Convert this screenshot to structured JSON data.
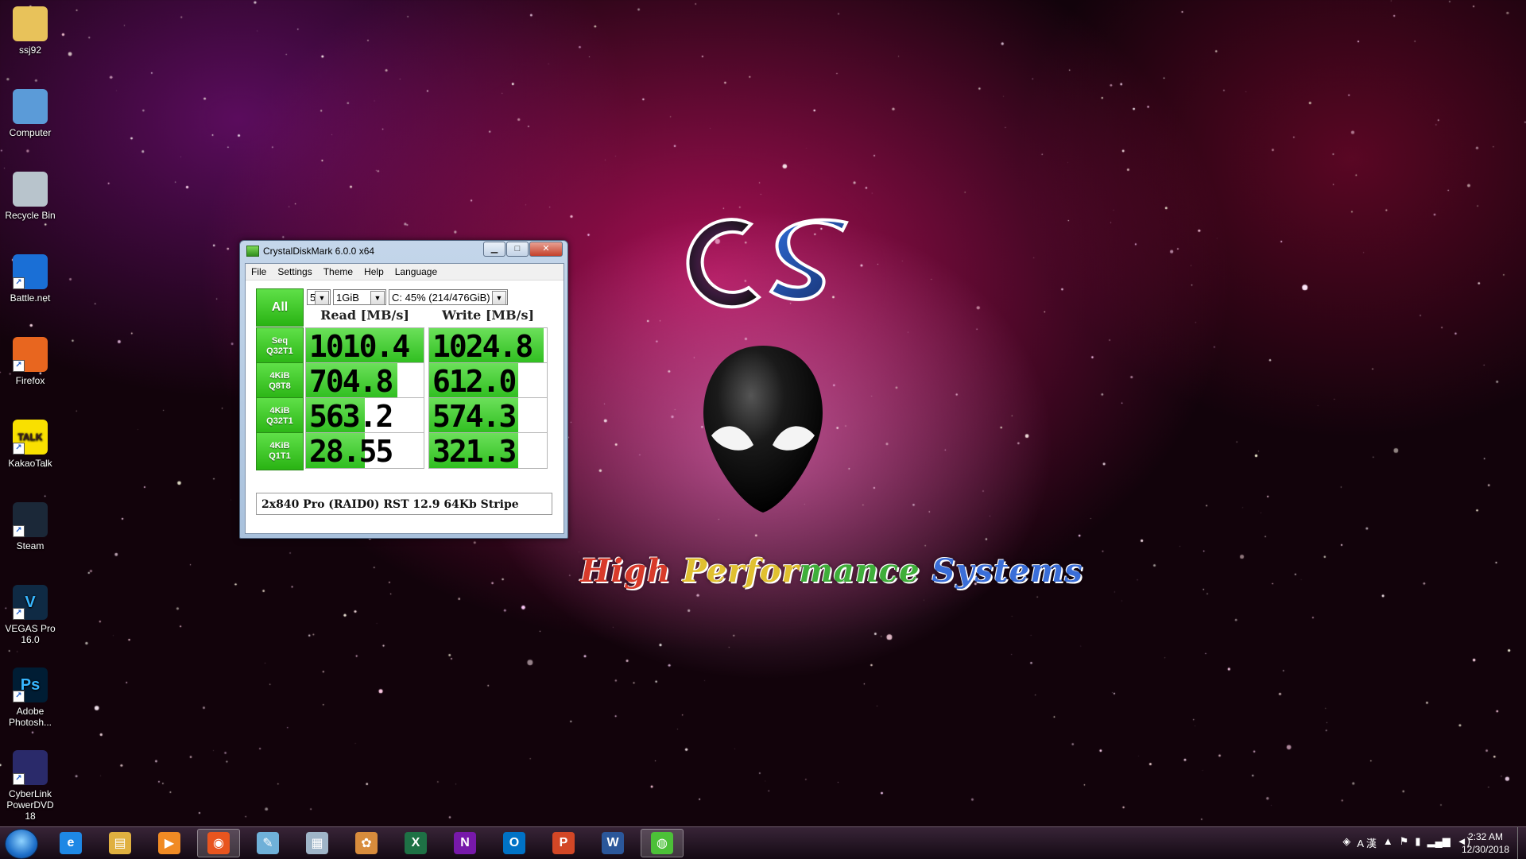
{
  "desktop": {
    "icons": [
      {
        "label": "ssj92",
        "icon": "folder-icon"
      },
      {
        "label": "Computer",
        "icon": "computer-icon"
      },
      {
        "label": "Recycle Bin",
        "icon": "recycle-bin-icon"
      },
      {
        "label": "Battle.net",
        "icon": "battlenet-icon"
      },
      {
        "label": "Firefox",
        "icon": "firefox-icon"
      },
      {
        "label": "KakaoTalk",
        "icon": "kakaotalk-icon",
        "glyph": "TALK"
      },
      {
        "label": "Steam",
        "icon": "steam-icon"
      },
      {
        "label": "VEGAS Pro 16.0",
        "icon": "vegas-icon",
        "glyph": "V"
      },
      {
        "label": "Adobe Photosh...",
        "icon": "photoshop-icon",
        "glyph": "Ps"
      },
      {
        "label": "CyberLink PowerDVD 18",
        "icon": "powerdvd-icon"
      }
    ]
  },
  "wallpaper": {
    "logo_text": "Cs",
    "tagline": "High Performance Systems"
  },
  "cdm": {
    "title": "CrystalDiskMark 6.0.0 x64",
    "menu": [
      "File",
      "Settings",
      "Theme",
      "Help",
      "Language"
    ],
    "all_label": "All",
    "count": "5",
    "size": "1GiB",
    "drive": "C: 45% (214/476GiB)",
    "read_header": "Read [MB/s]",
    "write_header": "Write [MB/s]",
    "rows": [
      {
        "line1": "Seq",
        "line2": "Q32T1",
        "read": "1010.4",
        "write": "1024.8",
        "read_fill": 1.0,
        "write_fill": 0.97
      },
      {
        "line1": "4KiB",
        "line2": "Q8T8",
        "read": "704.8",
        "write": "612.0",
        "read_fill": 0.78,
        "write_fill": 0.76
      },
      {
        "line1": "4KiB",
        "line2": "Q32T1",
        "read": "563.2",
        "write": "574.3",
        "read_fill": 0.5,
        "write_fill": 0.76
      },
      {
        "line1": "4KiB",
        "line2": "Q1T1",
        "read": "28.55",
        "write": "321.3",
        "read_fill": 0.5,
        "write_fill": 0.76
      }
    ],
    "comment": "2x840 Pro (RAID0) RST 12.9 64Kb Stripe"
  },
  "taskbar": {
    "items": [
      {
        "name": "ie",
        "glyph": "e",
        "color": "#1e88e5"
      },
      {
        "name": "explorer",
        "glyph": "▤",
        "color": "#e0b040"
      },
      {
        "name": "media-player",
        "glyph": "▶",
        "color": "#f08a24"
      },
      {
        "name": "firefox",
        "glyph": "◉",
        "color": "#e8551f",
        "active": true
      },
      {
        "name": "notepad",
        "glyph": "✎",
        "color": "#6fb0d8"
      },
      {
        "name": "calculator",
        "glyph": "▦",
        "color": "#9fb5c8"
      },
      {
        "name": "paint",
        "glyph": "✿",
        "color": "#d88c3c"
      },
      {
        "name": "excel",
        "glyph": "X",
        "color": "#1e7145"
      },
      {
        "name": "onenote",
        "glyph": "N",
        "color": "#7719aa"
      },
      {
        "name": "outlook",
        "glyph": "O",
        "color": "#0072c6"
      },
      {
        "name": "powerpoint",
        "glyph": "P",
        "color": "#d24726"
      },
      {
        "name": "word",
        "glyph": "W",
        "color": "#2b579a"
      },
      {
        "name": "crystaldiskmark",
        "glyph": "◍",
        "color": "#4cc038",
        "active": true
      }
    ],
    "tray_ime": "A 漢",
    "time": "2:32 AM",
    "date": "12/30/2018"
  }
}
